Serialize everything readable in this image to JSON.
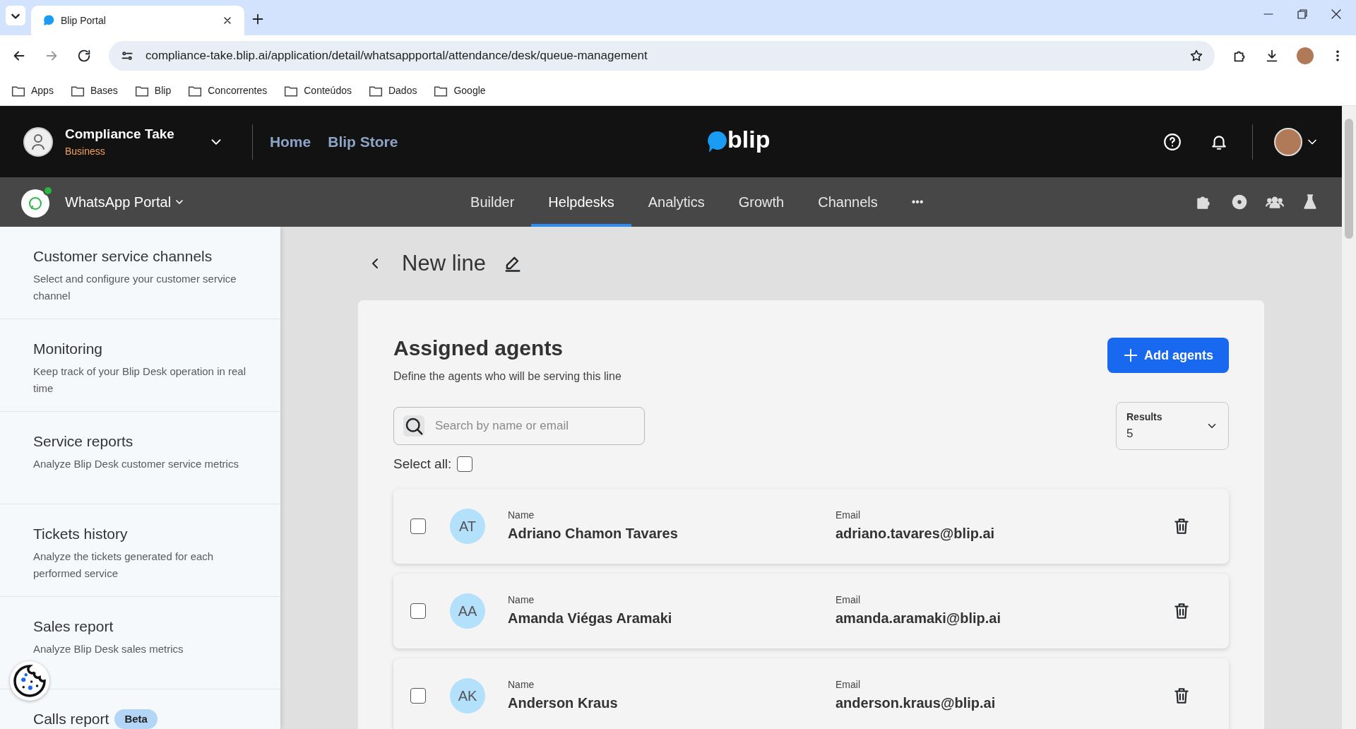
{
  "browser": {
    "tab_title": "Blip Portal",
    "url": "compliance-take.blip.ai/application/detail/whatsappportal/attendance/desk/queue-management",
    "bookmarks": [
      "Apps",
      "Bases",
      "Blip",
      "Concorrentes",
      "Conteúdos",
      "Dados",
      "Google"
    ]
  },
  "app_header": {
    "account_name": "Compliance Take",
    "account_plan": "Business",
    "links": [
      "Home",
      "Blip Store"
    ],
    "logo": "blip"
  },
  "subnav": {
    "bot_name": "WhatsApp Portal",
    "more": "•••",
    "tabs": [
      {
        "label": "Builder",
        "selected": false
      },
      {
        "label": "Helpdesks",
        "selected": true
      },
      {
        "label": "Analytics",
        "selected": false
      },
      {
        "label": "Growth",
        "selected": false
      },
      {
        "label": "Channels",
        "selected": false
      }
    ]
  },
  "sidebar": {
    "items": [
      {
        "title": "Customer service channels",
        "description": "Select and configure your customer service channel"
      },
      {
        "title": "Monitoring",
        "description": "Keep track of your Blip Desk operation in real time"
      },
      {
        "title": "Service reports",
        "description": "Analyze Blip Desk customer service metrics"
      },
      {
        "title": "Tickets history",
        "description": "Analyze the tickets generated for each performed service"
      },
      {
        "title": "Sales report",
        "description": "Analyze Blip Desk sales metrics"
      },
      {
        "title": "Calls report",
        "badge": "Beta"
      }
    ]
  },
  "page": {
    "title": "New line",
    "section_title": "Assigned agents",
    "section_subtitle": "Define the agents who will be serving this line",
    "add_button": "Add agents",
    "search": {
      "placeholder": "Search by name or email"
    },
    "results": {
      "label": "Results",
      "value": "5"
    },
    "select_all": {
      "label": "Select all:",
      "checked": false
    }
  },
  "agents": [
    {
      "initials": "AT",
      "name_label": "Name",
      "name": "Adriano Chamon Tavares",
      "email_label": "Email",
      "email": "adriano.tavares@blip.ai",
      "checked": false
    },
    {
      "initials": "AA",
      "name_label": "Name",
      "name": "Amanda Viégas Aramaki",
      "email_label": "Email",
      "email": "amanda.aramaki@blip.ai",
      "checked": false
    },
    {
      "initials": "AK",
      "name_label": "Name",
      "name": "Anderson Kraus",
      "email_label": "Email",
      "email": "anderson.kraus@blip.ai",
      "checked": false
    }
  ]
}
